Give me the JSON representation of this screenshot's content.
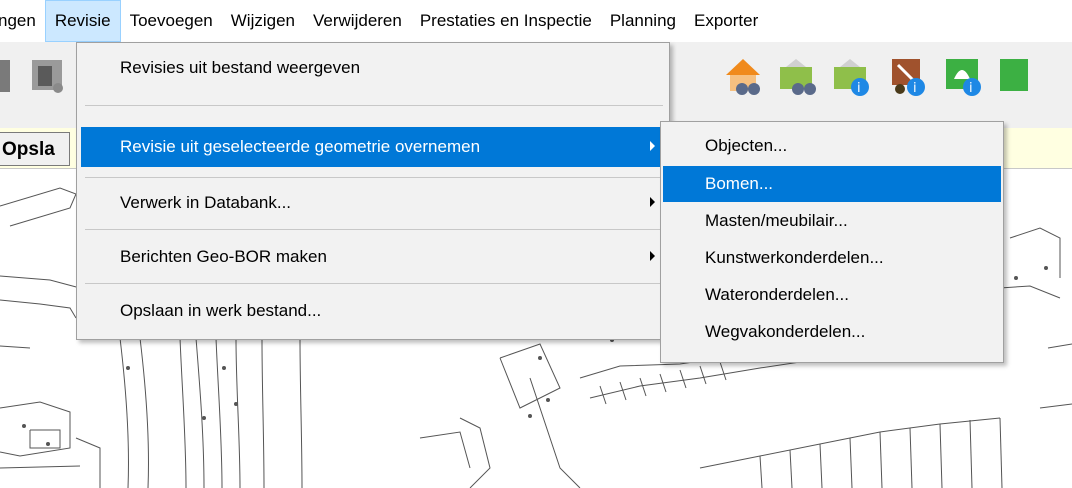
{
  "menubar": {
    "items": [
      "ngen",
      "Revisie",
      "Toevoegen",
      "Wijzigen",
      "Verwijderen",
      "Prestaties en Inspectie",
      "Planning",
      "Exporter"
    ]
  },
  "tab_row": {
    "label": "Opsla"
  },
  "revisie_menu": {
    "items": [
      {
        "label": "Revisies uit bestand weergeven",
        "has_submenu": false
      },
      {
        "label": "Revisie uit geselecteerde geometrie overnemen",
        "has_submenu": true,
        "highlighted": true
      },
      {
        "label": "Verwerk in Databank...",
        "has_submenu": true
      },
      {
        "label": "Berichten Geo-BOR maken",
        "has_submenu": true
      },
      {
        "label": "Opslaan in werk bestand...",
        "has_submenu": false
      }
    ]
  },
  "submenu": {
    "items": [
      {
        "label": "Objecten..."
      },
      {
        "label": "Bomen...",
        "highlighted": true
      },
      {
        "label": "Masten/meubilair..."
      },
      {
        "label": "Kunstwerkonderdelen..."
      },
      {
        "label": "Wateronderdelen..."
      },
      {
        "label": "Wegvakonderdelen..."
      }
    ]
  },
  "toolbar": {
    "icons": [
      "toolbar-tool-icon",
      "toolbar-binoculars-icon",
      "home-binoculars-icon",
      "folder-binoculars-icon",
      "folder-info-icon",
      "tools-info-icon",
      "tree-info-icon"
    ]
  },
  "colors": {
    "highlight": "#0078d7",
    "menubar_active": "#cce8ff",
    "tabrow": "#ffffe1"
  }
}
